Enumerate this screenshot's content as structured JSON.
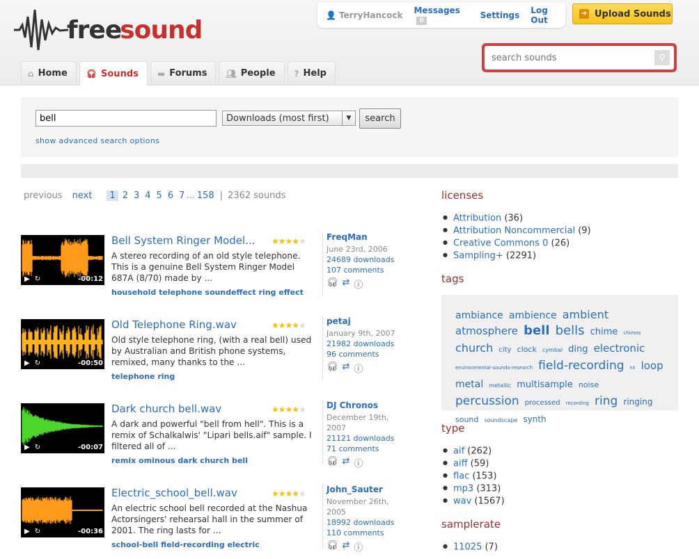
{
  "logo": {
    "part1": "free",
    "part2": "sound"
  },
  "userbar": {
    "username": "TerryHancock",
    "messages": "Messages",
    "messages_count": "0",
    "settings": "Settings",
    "logout": "Log Out"
  },
  "upload": {
    "label": "Upload Sounds"
  },
  "header_search": {
    "placeholder": "search sounds"
  },
  "tabs": [
    {
      "label": "Home",
      "icon": "home-icon"
    },
    {
      "label": "Sounds",
      "icon": "headphones-icon",
      "active": true
    },
    {
      "label": "Forums",
      "icon": "speech-bubble-icon"
    },
    {
      "label": "People",
      "icon": "people-icon"
    },
    {
      "label": "Help",
      "icon": "help-icon"
    }
  ],
  "search": {
    "query": "bell",
    "sort": "Downloads (most first)",
    "button": "search",
    "advanced": "show advanced search options"
  },
  "pager": {
    "previous": "previous",
    "next": "next",
    "pages": [
      "1",
      "2",
      "3",
      "4",
      "5",
      "6",
      "7"
    ],
    "ellipsis": "...",
    "last": "158",
    "separator": "|",
    "count": "2362 sounds"
  },
  "results": [
    {
      "title": "Bell System Ringer Model...",
      "rating": 4.5,
      "description": "A stereo recording of an old style telephone. This is a genuine Bell System Ringer Model 687A (8/70) made by ...",
      "tags": "household telephone soundeffect ring effect",
      "author": "FreqMan",
      "date": "June 23rd, 2006",
      "downloads": "24689 downloads",
      "comments": "107 comments",
      "duration": "-00:12",
      "wave_color": "#ff9a1a"
    },
    {
      "title": "Old Telephone Ring.wav",
      "rating": 4.5,
      "description": "Old style telephone ring, (with a real bell) used by Australian and British phone systems, remixed, many thanks to the ...",
      "tags": "telephone ring",
      "author": "petaj",
      "date": "January 9th, 2007",
      "downloads": "21982 downloads",
      "comments": "96 comments",
      "duration": "-00:50",
      "wave_color": "#ffb21a"
    },
    {
      "title": "Dark church bell.wav",
      "rating": 4.5,
      "description": "A dark and powerful \"bell from hell\". This is a remix of Schalkalwis' \"Lipari bells.aif\" sample. I filtered all of ...",
      "tags": "remix ominous dark church bell",
      "author": "DJ Chronos",
      "date": "December 19th, 2007",
      "downloads": "21121 downloads",
      "comments": "71 comments",
      "duration": "-00:07",
      "wave_color": "#4cd62a"
    },
    {
      "title": "Electric_school_bell.wav",
      "rating": 4.5,
      "description": "An electric school bell recorded at the Nashua Actorsingers' rehearsal hall in the summer of 2001. The ring lasts for ...",
      "tags": "school-bell field-recording electric",
      "author": "John_Sauter",
      "date": "November 26th, 2005",
      "downloads": "18992 downloads",
      "comments": "110 comments",
      "duration": "-00:36",
      "wave_color": "#ff9a1a"
    }
  ],
  "sidebar": {
    "licenses": {
      "heading": "licenses",
      "items": [
        {
          "label": "Attribution",
          "count": "(36)"
        },
        {
          "label": "Attribution Noncommercial",
          "count": "(9)"
        },
        {
          "label": "Creative Commons 0",
          "count": "(26)"
        },
        {
          "label": "Sampling+",
          "count": "(2291)"
        }
      ]
    },
    "tags_heading": "tags",
    "tagcloud": [
      {
        "t": "ambiance",
        "s": 14
      },
      {
        "t": "ambience",
        "s": 14
      },
      {
        "t": "ambient",
        "s": 16
      },
      {
        "t": "atmosphere",
        "s": 15
      },
      {
        "t": "bell",
        "s": 18,
        "b": true
      },
      {
        "t": "bells",
        "s": 18
      },
      {
        "t": "chime",
        "s": 13
      },
      {
        "t": "chimes",
        "s": 7
      },
      {
        "t": "church",
        "s": 16
      },
      {
        "t": "city",
        "s": 10
      },
      {
        "t": "clock",
        "s": 11
      },
      {
        "t": "cymbal",
        "s": 8
      },
      {
        "t": "ding",
        "s": 13
      },
      {
        "t": "electronic",
        "s": 15
      },
      {
        "t": "environmental-sounds-research",
        "s": 7
      },
      {
        "t": "field-recording",
        "s": 17
      },
      {
        "t": "hit",
        "s": 6
      },
      {
        "t": "loop",
        "s": 15
      },
      {
        "t": "metal",
        "s": 14
      },
      {
        "t": "metallic",
        "s": 8
      },
      {
        "t": "multisample",
        "s": 13
      },
      {
        "t": "noise",
        "s": 11
      },
      {
        "t": "percussion",
        "s": 17
      },
      {
        "t": "processed",
        "s": 10
      },
      {
        "t": "recording",
        "s": 7
      },
      {
        "t": "ring",
        "s": 17
      },
      {
        "t": "ringing",
        "s": 12
      },
      {
        "t": "sound",
        "s": 11
      },
      {
        "t": "soundscape",
        "s": 8
      },
      {
        "t": "synth",
        "s": 12
      }
    ],
    "type": {
      "heading": "type",
      "items": [
        {
          "label": "aif",
          "count": "(262)"
        },
        {
          "label": "aiff",
          "count": "(59)"
        },
        {
          "label": "flac",
          "count": "(153)"
        },
        {
          "label": "mp3",
          "count": "(313)"
        },
        {
          "label": "wav",
          "count": "(1567)"
        }
      ]
    },
    "samplerate": {
      "heading": "samplerate",
      "items": [
        {
          "label": "11025",
          "count": "(7)"
        }
      ]
    }
  },
  "colors": {
    "link": "#2a6ebb",
    "brand_red": "#c8302c",
    "section_heading": "#9a2d2d",
    "upload_yellow": "#f6c21c"
  }
}
